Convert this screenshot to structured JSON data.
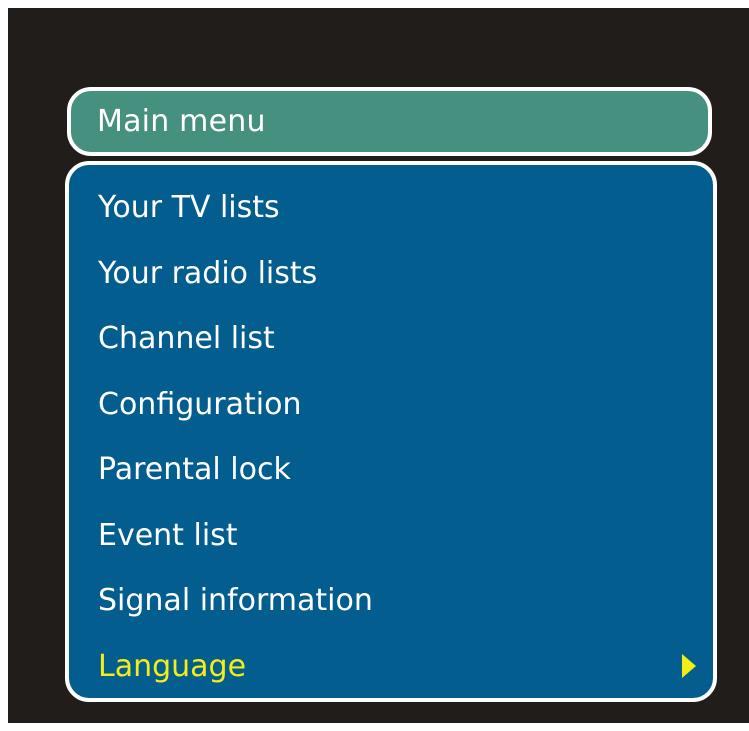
{
  "menu": {
    "title": "Main menu",
    "items": [
      {
        "label": "Your TV lists"
      },
      {
        "label": "Your radio lists"
      },
      {
        "label": "Channel list"
      },
      {
        "label": "Configuration"
      },
      {
        "label": "Parental lock"
      },
      {
        "label": "Event list"
      },
      {
        "label": "Signal information"
      },
      {
        "label": "Language"
      }
    ],
    "selected_item": "Language"
  },
  "colors": {
    "background": "#211d1b",
    "title_bar": "#45907e",
    "panel": "#035d8f",
    "text": "#ffffff",
    "highlight": "#f4ee14"
  },
  "icons": {
    "submenu_indicator": "right-arrow-icon"
  }
}
